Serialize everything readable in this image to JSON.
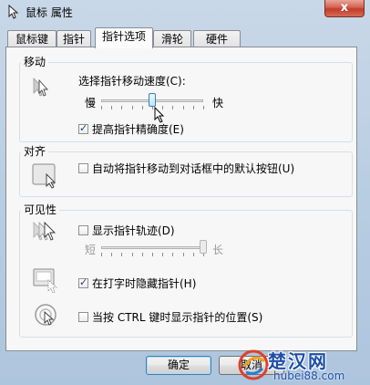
{
  "window": {
    "title": "鼠标 属性",
    "close_label": "x"
  },
  "tabs": [
    {
      "label": "鼠标键",
      "active": false
    },
    {
      "label": "指针",
      "active": false
    },
    {
      "label": "指针选项",
      "active": true
    },
    {
      "label": "滑轮",
      "active": false
    },
    {
      "label": "硬件",
      "active": false
    }
  ],
  "motion": {
    "title": "移动",
    "speed_label": "选择指针移动速度(C):",
    "slow_label": "慢",
    "fast_label": "快",
    "speed_level": 0.5,
    "precision_label": "提高指针精确度(E)",
    "precision_checked": true
  },
  "snap": {
    "title": "对齐",
    "snap_label": "自动将指针移动到对话框中的默认按钮(U)",
    "snap_checked": false
  },
  "visibility": {
    "title": "可见性",
    "trails_label": "显示指针轨迹(D)",
    "trails_checked": false,
    "short_label": "短",
    "long_label": "长",
    "trails_level": 1.0,
    "hide_label": "在打字时隐藏指针(H)",
    "hide_checked": true,
    "ctrl_label": "当按 CTRL 键时显示指针的位置(S)",
    "ctrl_checked": false
  },
  "buttons": {
    "ok": "确定",
    "cancel": "取消"
  },
  "watermark": {
    "name": "楚汉网",
    "url": "hubei88.com"
  }
}
